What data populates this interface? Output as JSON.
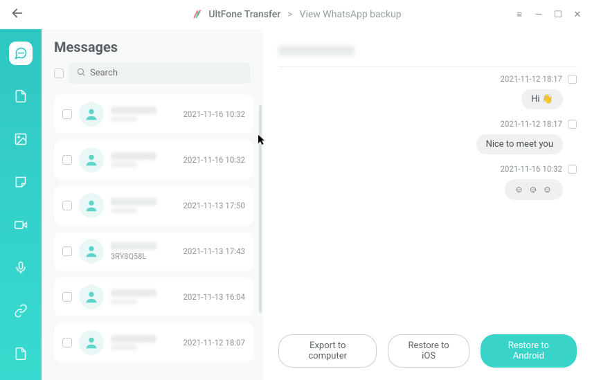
{
  "titlebar": {
    "app_name": "UltFone Transfer",
    "crumb_sep": ">",
    "crumb_last": "View WhatsApp backup"
  },
  "nav": {
    "items": [
      "chat",
      "document",
      "image",
      "sticker",
      "video",
      "voice",
      "link",
      "file"
    ]
  },
  "list": {
    "heading": "Messages",
    "search_placeholder": "Search",
    "items": [
      {
        "time": "2021-11-16 10:32",
        "subtext": ""
      },
      {
        "time": "2021-11-16 10:32",
        "subtext": ""
      },
      {
        "time": "2021-11-13 17:50",
        "subtext": ""
      },
      {
        "time": "2021-11-13 17:43",
        "subtext": "3RY8Q58L"
      },
      {
        "time": "2021-11-13 16:04",
        "subtext": ""
      },
      {
        "time": "2021-11-12 18:07",
        "subtext": ""
      }
    ]
  },
  "chat": {
    "messages": [
      {
        "time": "2021-11-12 18:17",
        "text": "Hi 👋"
      },
      {
        "time": "2021-11-12 18:17",
        "text": "Nice to meet you"
      },
      {
        "time": "2021-11-16 10:32",
        "text": "☺ ☺ ☺"
      }
    ]
  },
  "actions": {
    "export": "Export to computer",
    "restore_ios": "Restore to iOS",
    "restore_android": "Restore to Android"
  }
}
